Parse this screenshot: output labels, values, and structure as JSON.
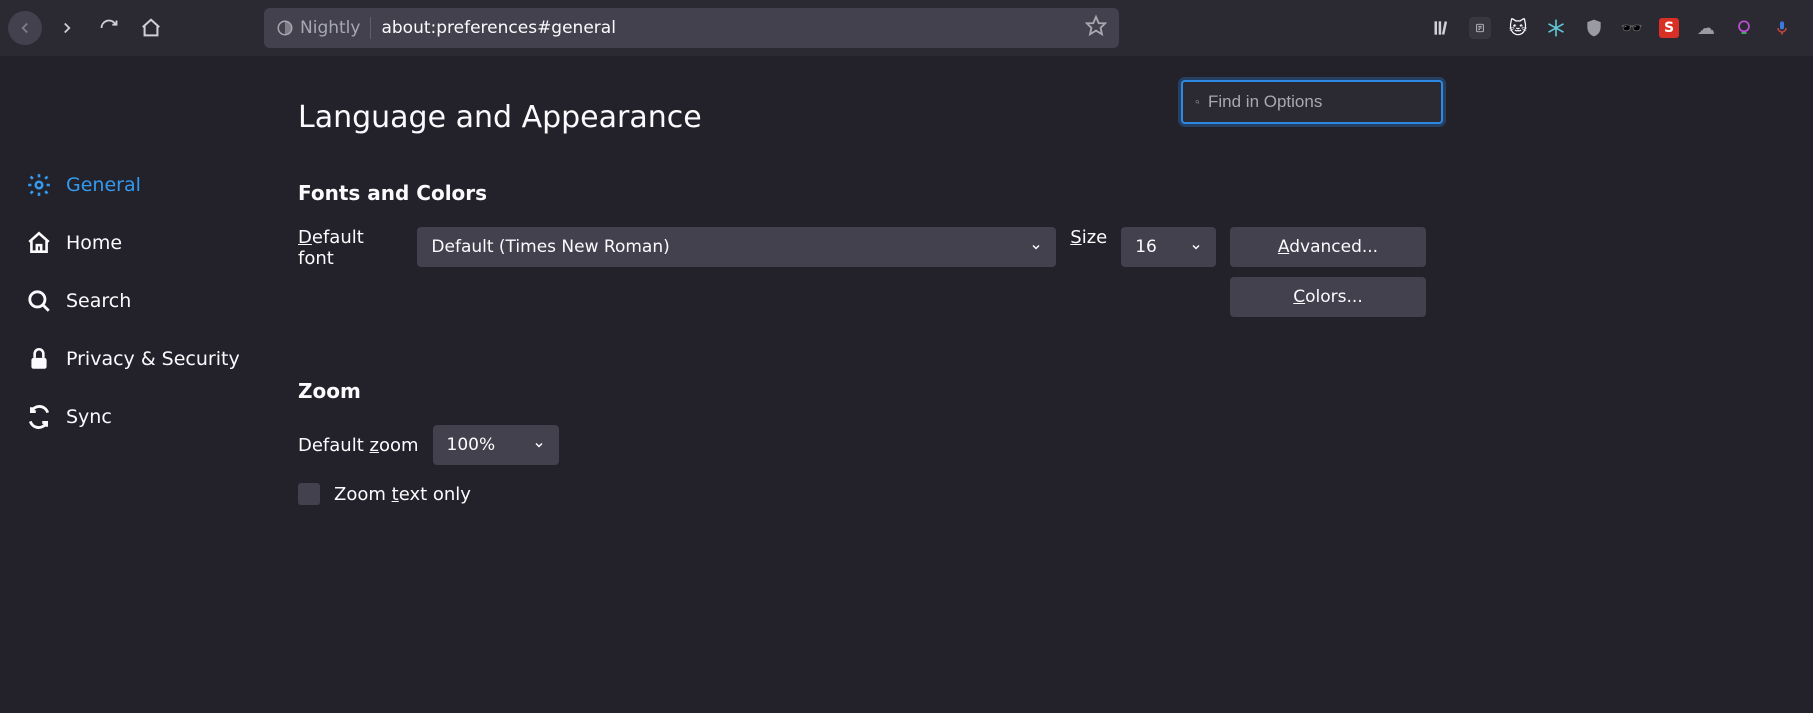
{
  "toolbar": {
    "identity": "Nightly",
    "url": "about:preferences#general"
  },
  "find": {
    "placeholder": "Find in Options"
  },
  "sidebar": {
    "items": [
      {
        "label": "General"
      },
      {
        "label": "Home"
      },
      {
        "label": "Search"
      },
      {
        "label": "Privacy & Security"
      },
      {
        "label": "Sync"
      }
    ]
  },
  "main": {
    "section_title": "Language and Appearance",
    "fonts": {
      "title": "Fonts and Colors",
      "default_font_label_pre": "D",
      "default_font_label_post": "efault font",
      "default_font_value": "Default (Times New Roman)",
      "size_label_pre": "S",
      "size_label_post": "ize",
      "size_value": "16",
      "advanced_pre": "A",
      "advanced_post": "dvanced...",
      "colors_pre": "C",
      "colors_post": "olors..."
    },
    "zoom": {
      "title": "Zoom",
      "default_zoom_label_pre": "Default ",
      "default_zoom_label_ul": "z",
      "default_zoom_label_post": "oom",
      "default_zoom_value": "100%",
      "text_only_pre": "Zoom ",
      "text_only_ul": "t",
      "text_only_post": "ext only"
    }
  }
}
